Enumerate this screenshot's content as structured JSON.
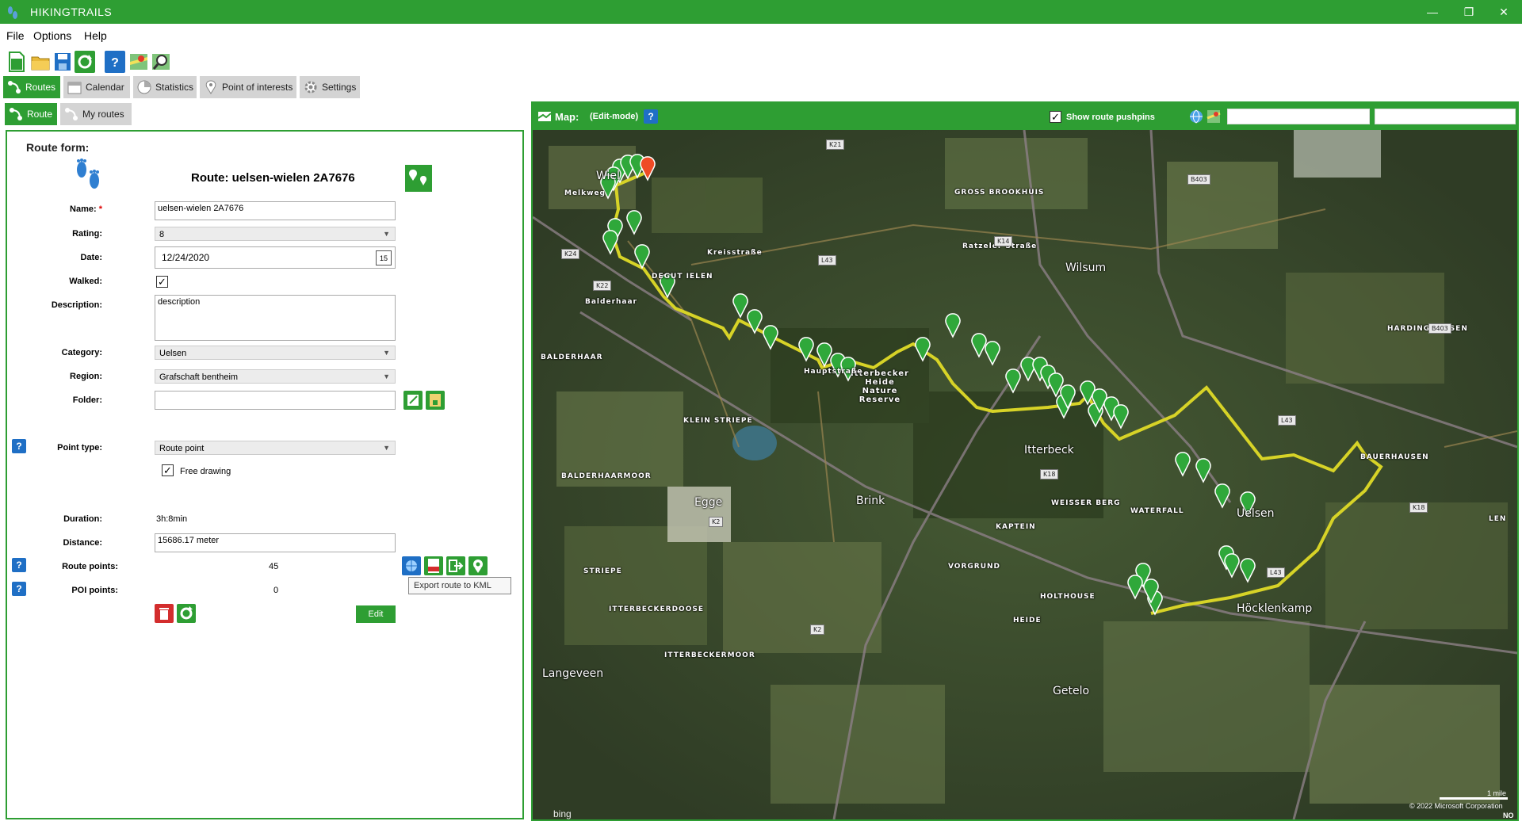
{
  "window": {
    "title": "HIKINGTRAILS",
    "minimize": "—",
    "restore": "❐",
    "close": "✕"
  },
  "menu": {
    "file": "File",
    "options": "Options",
    "help": "Help"
  },
  "tabs": {
    "routes": "Routes",
    "calendar": "Calendar",
    "statistics": "Statistics",
    "poi": "Point of interests",
    "settings": "Settings"
  },
  "subtabs": {
    "route": "Route",
    "my_routes": "My routes"
  },
  "form": {
    "title": "Route form:",
    "heading": "Route: uelsen-wielen 2A7676",
    "name_label": "Name:",
    "required_mark": "*",
    "name_value": "uelsen-wielen 2A7676",
    "rating_label": "Rating:",
    "rating_value": "8",
    "date_label": "Date:",
    "date_value": "12/24/2020",
    "calendar_day": "15",
    "walked_label": "Walked:",
    "walked_checked": "✓",
    "description_label": "Description:",
    "description_value": "description",
    "category_label": "Category:",
    "category_value": "Uelsen",
    "region_label": "Region:",
    "region_value": "Grafschaft bentheim",
    "folder_label": "Folder:",
    "folder_value": "",
    "point_type_label": "Point type:",
    "point_type_value": "Route point",
    "free_drawing_label": "Free drawing",
    "free_drawing_checked": "✓",
    "duration_label": "Duration:",
    "duration_value": "3h:8min",
    "distance_label": "Distance:",
    "distance_value": "15686.17 meter",
    "route_points_label": "Route points:",
    "route_points_value": "45",
    "poi_points_label": "POI points:",
    "poi_points_value": "0",
    "edit_button": "Edit",
    "tooltip": "Export route to KML",
    "help_symbol": "?"
  },
  "map": {
    "title": "Map:",
    "mode": "(Edit-mode)",
    "show_pushpins_label": "Show route pushpins",
    "show_pushpins_checked": "✓",
    "search1": "",
    "search2": "",
    "copyright": "© 2022 Microsoft Corporation",
    "scale_label": "1 mile",
    "corner_label": "NO",
    "bing": "bing",
    "places": [
      "Wiel",
      "GROSS BROOKHUIS",
      "Wilsum",
      "HARDINGHAUSEN",
      "BALDERHAAR",
      "Itterbecker Heide Nature Reserve",
      "KLEIN STRIEPE",
      "Itterbeck",
      "BAUERHAUSEN",
      "BALDERHAARMOOR",
      "Egge",
      "Brink",
      "WEISSER BERG",
      "WATERFALL",
      "Uelsen",
      "KAPTEIN",
      "VORGRUND",
      "STRIEPE",
      "HOLTHOUSE",
      "Höcklenkamp",
      "ITTERBECKERDOOSE",
      "HEIDE",
      "ITTERBECKERMOOR",
      "Langeveen",
      "Getelo",
      "Hauptstraße",
      "Ratzeler Straße",
      "Balderhaar",
      "Kreisstraße",
      "Melkweg",
      "LEN",
      "DEGUT IELEN"
    ],
    "roads": [
      "K21",
      "B403",
      "K14",
      "L43",
      "K24",
      "K22",
      "B403",
      "L43",
      "K18",
      "K2",
      "L43",
      "K18",
      "K2"
    ],
    "colors": {
      "route": "#d7d327",
      "pin": "#2fa83a",
      "pin_end": "#ef4b26",
      "accent": "#2e9e33"
    }
  }
}
